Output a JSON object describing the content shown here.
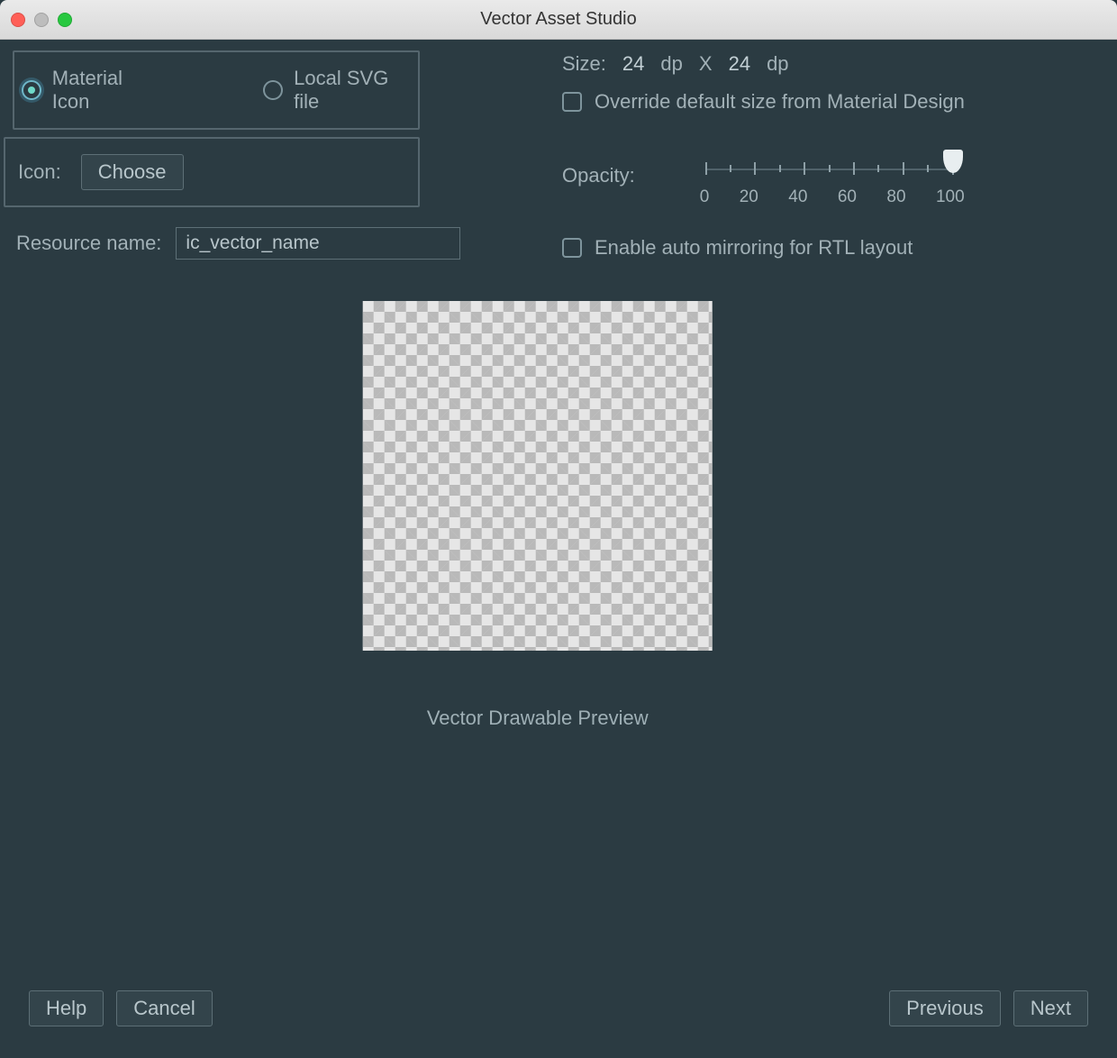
{
  "titlebar": {
    "title": "Vector Asset Studio"
  },
  "source": {
    "material_label": "Material Icon",
    "svg_label": "Local SVG file",
    "selected": "material"
  },
  "icon_row": {
    "label": "Icon:",
    "choose_btn": "Choose"
  },
  "resname": {
    "label": "Resource name:",
    "value": "ic_vector_name"
  },
  "size": {
    "label": "Size:",
    "width": "24",
    "unit1": "dp",
    "sep": "X",
    "height": "24",
    "unit2": "dp",
    "override_label": "Override default size from Material Design"
  },
  "opacity": {
    "label": "Opacity:",
    "ticks": [
      "0",
      "20",
      "40",
      "60",
      "80",
      "100"
    ],
    "value": 100
  },
  "rtl": {
    "label": "Enable auto mirroring for RTL layout"
  },
  "preview": {
    "caption": "Vector Drawable Preview"
  },
  "footer": {
    "help": "Help",
    "cancel": "Cancel",
    "previous": "Previous",
    "next": "Next"
  }
}
